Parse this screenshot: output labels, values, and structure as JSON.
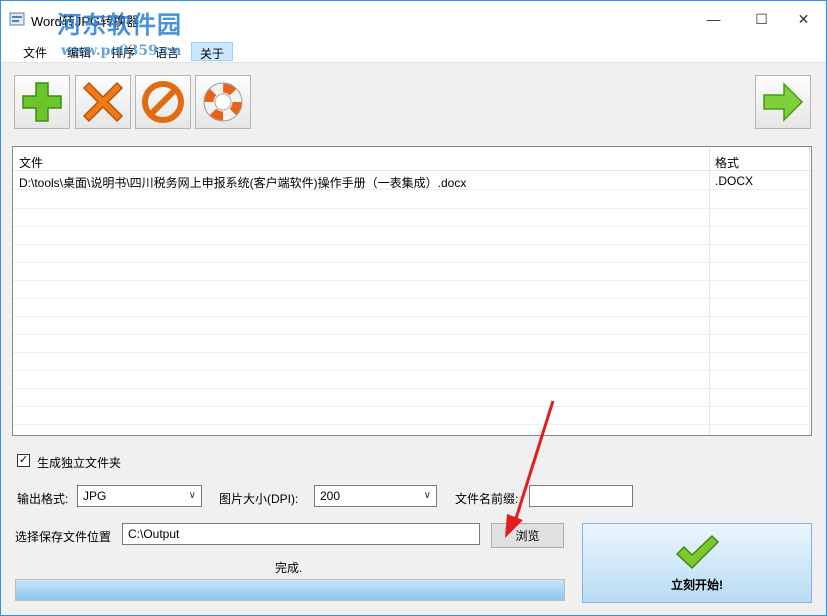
{
  "window": {
    "title": "Word转JPG转换器",
    "watermark": "河东软件园",
    "watermark_url": "www.pc0359.cn",
    "min_glyph": "—",
    "max_glyph": "☐",
    "close_glyph": "✕"
  },
  "menu": {
    "items": [
      "文件",
      "编辑",
      "排序",
      "语言",
      "关于"
    ]
  },
  "toolbar": {
    "buttons": [
      "add-icon",
      "delete-icon",
      "clear-icon",
      "help-icon",
      "next-icon"
    ]
  },
  "filelist": {
    "headers": {
      "file": "文件",
      "format": "格式"
    },
    "rows": [
      {
        "file": "D:\\tools\\桌面\\说明书\\四川税务网上申报系统(客户端软件)操作手册（一表集成）.docx",
        "format": ".DOCX"
      }
    ]
  },
  "options": {
    "separate_folder_label": "生成独立文件夹",
    "separate_folder_checked": true,
    "check_glyph": "✓",
    "output_format_label": "输出格式:",
    "output_format_value": "JPG",
    "image_size_label": "图片大小(DPI):",
    "image_size_value": "200",
    "prefix_label": "文件名前缀:",
    "prefix_value": "",
    "dropdown_glyph": "∨"
  },
  "save": {
    "label": "选择保存文件位置",
    "path": "C:\\Output",
    "browse_label": "浏览"
  },
  "status": {
    "text": "完成.",
    "progress": 1.0
  },
  "start": {
    "label": "立刻开始!"
  },
  "colors": {
    "accent": "#2a7fd0",
    "green": "#5fbf1e",
    "orange": "#f07a18",
    "red_arrow": "#e01e1e"
  }
}
